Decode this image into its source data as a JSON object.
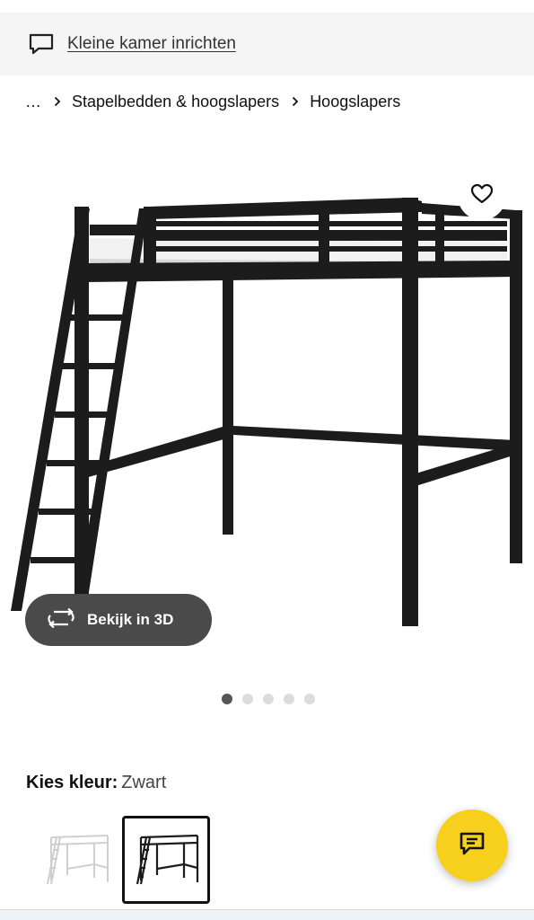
{
  "banner": {
    "link_text": "Kleine kamer inrichten",
    "icon": "chat-bubble-icon"
  },
  "breadcrumb": {
    "items": [
      "…",
      "Stapelbedden & hoogslapers",
      "Hoogslapers"
    ]
  },
  "product": {
    "image_icon": "loft-bed-black-image",
    "wishlist_icon": "heart-icon",
    "view3d_label": "Bekijk in 3D",
    "view3d_icon": "rotate-3d-icon",
    "carousel": {
      "count": 5,
      "active_index": 1
    }
  },
  "color": {
    "label": "Kies kleur:",
    "value": "Zwart",
    "options": [
      {
        "name": "white-variant",
        "color": "#ffffff"
      },
      {
        "name": "black-variant",
        "color": "#1a1a1a",
        "selected": true
      }
    ]
  },
  "chat": {
    "icon": "chat-icon",
    "color": "#f7cf1d"
  }
}
